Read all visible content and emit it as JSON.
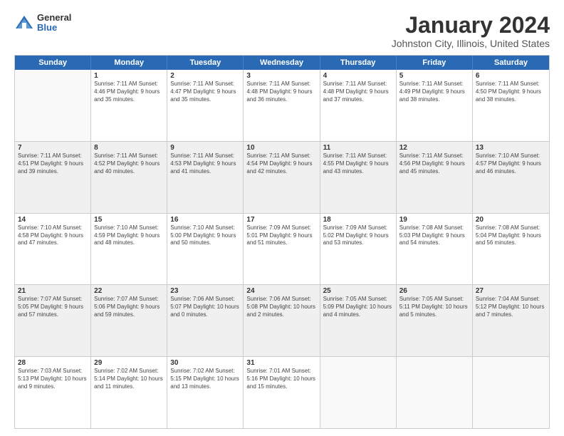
{
  "logo": {
    "general": "General",
    "blue": "Blue"
  },
  "title": "January 2024",
  "subtitle": "Johnston City, Illinois, United States",
  "weekdays": [
    "Sunday",
    "Monday",
    "Tuesday",
    "Wednesday",
    "Thursday",
    "Friday",
    "Saturday"
  ],
  "rows": [
    [
      {
        "day": "",
        "info": "",
        "empty": true
      },
      {
        "day": "1",
        "info": "Sunrise: 7:11 AM\nSunset: 4:46 PM\nDaylight: 9 hours\nand 35 minutes."
      },
      {
        "day": "2",
        "info": "Sunrise: 7:11 AM\nSunset: 4:47 PM\nDaylight: 9 hours\nand 35 minutes."
      },
      {
        "day": "3",
        "info": "Sunrise: 7:11 AM\nSunset: 4:48 PM\nDaylight: 9 hours\nand 36 minutes."
      },
      {
        "day": "4",
        "info": "Sunrise: 7:11 AM\nSunset: 4:48 PM\nDaylight: 9 hours\nand 37 minutes."
      },
      {
        "day": "5",
        "info": "Sunrise: 7:11 AM\nSunset: 4:49 PM\nDaylight: 9 hours\nand 38 minutes."
      },
      {
        "day": "6",
        "info": "Sunrise: 7:11 AM\nSunset: 4:50 PM\nDaylight: 9 hours\nand 38 minutes."
      }
    ],
    [
      {
        "day": "7",
        "info": "Sunrise: 7:11 AM\nSunset: 4:51 PM\nDaylight: 9 hours\nand 39 minutes.",
        "shaded": true
      },
      {
        "day": "8",
        "info": "Sunrise: 7:11 AM\nSunset: 4:52 PM\nDaylight: 9 hours\nand 40 minutes.",
        "shaded": true
      },
      {
        "day": "9",
        "info": "Sunrise: 7:11 AM\nSunset: 4:53 PM\nDaylight: 9 hours\nand 41 minutes.",
        "shaded": true
      },
      {
        "day": "10",
        "info": "Sunrise: 7:11 AM\nSunset: 4:54 PM\nDaylight: 9 hours\nand 42 minutes.",
        "shaded": true
      },
      {
        "day": "11",
        "info": "Sunrise: 7:11 AM\nSunset: 4:55 PM\nDaylight: 9 hours\nand 43 minutes.",
        "shaded": true
      },
      {
        "day": "12",
        "info": "Sunrise: 7:11 AM\nSunset: 4:56 PM\nDaylight: 9 hours\nand 45 minutes.",
        "shaded": true
      },
      {
        "day": "13",
        "info": "Sunrise: 7:10 AM\nSunset: 4:57 PM\nDaylight: 9 hours\nand 46 minutes.",
        "shaded": true
      }
    ],
    [
      {
        "day": "14",
        "info": "Sunrise: 7:10 AM\nSunset: 4:58 PM\nDaylight: 9 hours\nand 47 minutes."
      },
      {
        "day": "15",
        "info": "Sunrise: 7:10 AM\nSunset: 4:59 PM\nDaylight: 9 hours\nand 48 minutes."
      },
      {
        "day": "16",
        "info": "Sunrise: 7:10 AM\nSunset: 5:00 PM\nDaylight: 9 hours\nand 50 minutes."
      },
      {
        "day": "17",
        "info": "Sunrise: 7:09 AM\nSunset: 5:01 PM\nDaylight: 9 hours\nand 51 minutes."
      },
      {
        "day": "18",
        "info": "Sunrise: 7:09 AM\nSunset: 5:02 PM\nDaylight: 9 hours\nand 53 minutes."
      },
      {
        "day": "19",
        "info": "Sunrise: 7:08 AM\nSunset: 5:03 PM\nDaylight: 9 hours\nand 54 minutes."
      },
      {
        "day": "20",
        "info": "Sunrise: 7:08 AM\nSunset: 5:04 PM\nDaylight: 9 hours\nand 56 minutes."
      }
    ],
    [
      {
        "day": "21",
        "info": "Sunrise: 7:07 AM\nSunset: 5:05 PM\nDaylight: 9 hours\nand 57 minutes.",
        "shaded": true
      },
      {
        "day": "22",
        "info": "Sunrise: 7:07 AM\nSunset: 5:06 PM\nDaylight: 9 hours\nand 59 minutes.",
        "shaded": true
      },
      {
        "day": "23",
        "info": "Sunrise: 7:06 AM\nSunset: 5:07 PM\nDaylight: 10 hours\nand 0 minutes.",
        "shaded": true
      },
      {
        "day": "24",
        "info": "Sunrise: 7:06 AM\nSunset: 5:08 PM\nDaylight: 10 hours\nand 2 minutes.",
        "shaded": true
      },
      {
        "day": "25",
        "info": "Sunrise: 7:05 AM\nSunset: 5:09 PM\nDaylight: 10 hours\nand 4 minutes.",
        "shaded": true
      },
      {
        "day": "26",
        "info": "Sunrise: 7:05 AM\nSunset: 5:11 PM\nDaylight: 10 hours\nand 5 minutes.",
        "shaded": true
      },
      {
        "day": "27",
        "info": "Sunrise: 7:04 AM\nSunset: 5:12 PM\nDaylight: 10 hours\nand 7 minutes.",
        "shaded": true
      }
    ],
    [
      {
        "day": "28",
        "info": "Sunrise: 7:03 AM\nSunset: 5:13 PM\nDaylight: 10 hours\nand 9 minutes."
      },
      {
        "day": "29",
        "info": "Sunrise: 7:02 AM\nSunset: 5:14 PM\nDaylight: 10 hours\nand 11 minutes."
      },
      {
        "day": "30",
        "info": "Sunrise: 7:02 AM\nSunset: 5:15 PM\nDaylight: 10 hours\nand 13 minutes."
      },
      {
        "day": "31",
        "info": "Sunrise: 7:01 AM\nSunset: 5:16 PM\nDaylight: 10 hours\nand 15 minutes."
      },
      {
        "day": "",
        "info": "",
        "empty": true
      },
      {
        "day": "",
        "info": "",
        "empty": true
      },
      {
        "day": "",
        "info": "",
        "empty": true
      }
    ]
  ]
}
